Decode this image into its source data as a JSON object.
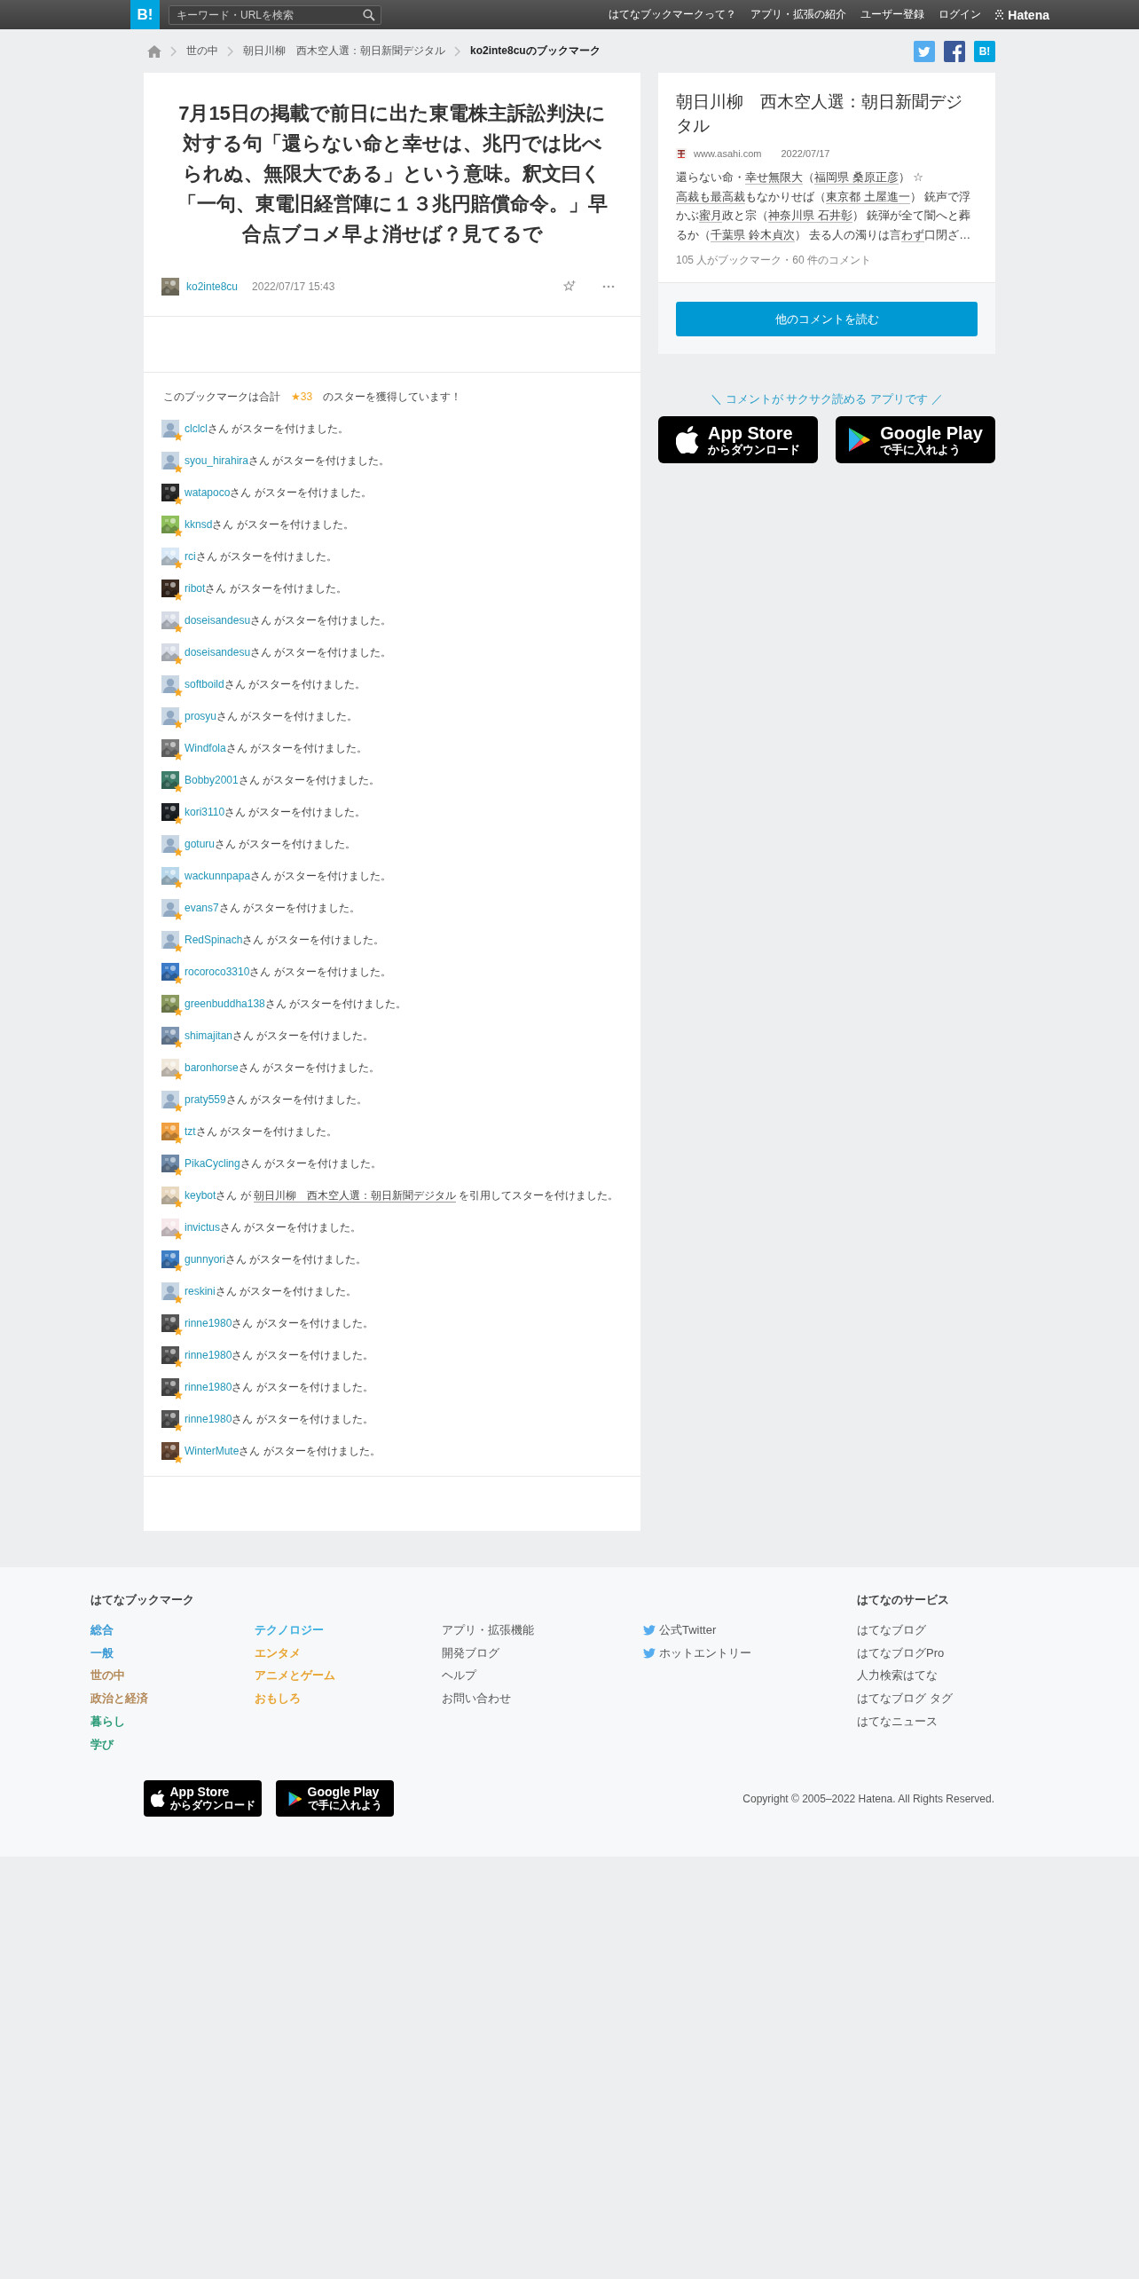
{
  "header": {
    "logo": "B!",
    "search": {
      "placeholder": "キーワード・URLを検索"
    },
    "nav": [
      "はてなブックマークって？",
      "アプリ・拡張の紹介",
      "ユーザー登録",
      "ログイン"
    ],
    "brand": "Hatena"
  },
  "breadcrumb": [
    {
      "label": "世の中",
      "current": false
    },
    {
      "label": "朝日川柳　西木空人選：朝日新聞デジタル",
      "current": false
    },
    {
      "label": "ko2inte8cuのブックマーク",
      "current": true
    }
  ],
  "share": [
    {
      "kind": "twitter"
    },
    {
      "kind": "facebook"
    },
    {
      "kind": "hatena",
      "label": "B!"
    }
  ],
  "bookmark": {
    "title": "7月15日の掲載で前日に出た東電株主訴訟判決に対する句「還らない命と幸せは、兆円では比べられぬ、無限大である」という意味。釈文曰く「一句、東電旧経営陣に１３兆円賠償命令。」早合点ブコメ早よ消せば？見てるで",
    "user": "ko2inte8cu",
    "date": "2022/07/17 15:43"
  },
  "stars": {
    "prefix": "このブックマークは合計",
    "total": "★33",
    "suffix": "のスターを獲得しています！",
    "list": [
      {
        "user": "clclcl",
        "avatar": {
          "kind": "default"
        },
        "text": "さん がスターを付けました。"
      },
      {
        "user": "syou_hirahira",
        "avatar": {
          "kind": "default"
        },
        "text": "さん がスターを付けました。"
      },
      {
        "user": "watapoco",
        "text": "さん がスターを付けました。"
      },
      {
        "user": "kknsd",
        "text": "さん がスターを付けました。"
      },
      {
        "user": "rci",
        "text": "さん がスターを付けました。"
      },
      {
        "user": "ribot",
        "text": "さん がスターを付けました。"
      },
      {
        "user": "doseisandesu",
        "text": "さん がスターを付けました。"
      },
      {
        "user": "doseisandesu",
        "text": "さん がスターを付けました。"
      },
      {
        "user": "softboild",
        "avatar": {
          "kind": "default"
        },
        "text": "さん がスターを付けました。"
      },
      {
        "user": "prosyu",
        "avatar": {
          "kind": "default"
        },
        "text": "さん がスターを付けました。"
      },
      {
        "user": "Windfola",
        "text": "さん がスターを付けました。"
      },
      {
        "user": "Bobby2001",
        "text": "さん がスターを付けました。"
      },
      {
        "user": "kori3110",
        "text": "さん がスターを付けました。"
      },
      {
        "user": "goturu",
        "avatar": {
          "kind": "default"
        },
        "text": "さん がスターを付けました。"
      },
      {
        "user": "wackunnpapa",
        "text": "さん がスターを付けました。"
      },
      {
        "user": "evans7",
        "avatar": {
          "kind": "default"
        },
        "text": "さん がスターを付けました。"
      },
      {
        "user": "RedSpinach",
        "avatar": {
          "kind": "default"
        },
        "text": "さん がスターを付けました。"
      },
      {
        "user": "rocoroco3310",
        "text": "さん がスターを付けました。"
      },
      {
        "user": "greenbuddha138",
        "text": "さん がスターを付けました。"
      },
      {
        "user": "shimajitan",
        "text": "さん がスターを付けました。"
      },
      {
        "user": "baronhorse",
        "text": "さん がスターを付けました。"
      },
      {
        "user": "praty559",
        "avatar": {
          "kind": "default"
        },
        "text": "さん がスターを付けました。"
      },
      {
        "user": "tzt",
        "text": "さん がスターを付けました。"
      },
      {
        "user": "PikaCycling",
        "text": "さん がスターを付けました。"
      },
      {
        "user": "keybot",
        "text": "さん が",
        "quote": "朝日川柳　西木空人選：朝日新聞デジタル",
        "after": "を引用してスターを付けました。"
      },
      {
        "user": "invictus",
        "text": "さん がスターを付けました。"
      },
      {
        "user": "gunnyori",
        "text": "さん がスターを付けました。"
      },
      {
        "user": "reskini",
        "avatar": {
          "kind": "default"
        },
        "text": "さん がスターを付けました。"
      },
      {
        "user": "rinne1980",
        "text": "さん がスターを付けました。"
      },
      {
        "user": "rinne1980",
        "text": "さん がスターを付けました。"
      },
      {
        "user": "rinne1980",
        "text": "さん がスターを付けました。"
      },
      {
        "user": "rinne1980",
        "text": "さん がスターを付けました。"
      },
      {
        "user": "WinterMute",
        "text": "さん がスターを付けました。"
      }
    ]
  },
  "entry": {
    "title": "朝日川柳　西木空人選：朝日新聞デジタル",
    "domain": "www.asahi.com",
    "date": "2022/07/17",
    "description": [
      {
        "text": "還らない命・",
        "keyword": false
      },
      {
        "text": "幸せ無限大",
        "keyword": true
      },
      {
        "text": "（",
        "keyword": false
      },
      {
        "text": "福岡県 桑原正彦",
        "keyword": true
      },
      {
        "text": "） ☆",
        "keyword": false
      },
      {
        "text": "高裁も最高裁",
        "keyword": true
      },
      {
        "text": "もなかりせば（",
        "keyword": false
      },
      {
        "text": "東京都 土屋進一",
        "keyword": true
      },
      {
        "text": "） 銃声で浮かぶ",
        "keyword": false
      },
      {
        "text": "蜜月",
        "keyword": true
      },
      {
        "text": "政と宗（",
        "keyword": false
      },
      {
        "text": "神奈川県 石井彰",
        "keyword": true
      },
      {
        "text": "） 銃弾が全て闇へと葬るか（",
        "keyword": false
      },
      {
        "text": "千葉県 鈴木貞次",
        "keyword": true
      },
      {
        "text": "） 去る人の濁りは言",
        "keyword": false
      },
      {
        "text": "わず",
        "keyword": true
      },
      {
        "text": "口閉ざ…",
        "keyword": false
      }
    ],
    "counts": "105 人がブックマーク・60 件のコメント",
    "button": "他のコメントを読む"
  },
  "app_promo": {
    "text": "＼ コメントが サクサク読める アプリです ／",
    "badges": [
      {
        "kind": "apple",
        "title": "App Store",
        "subtitle": "からダウンロード"
      },
      {
        "kind": "google",
        "title": "Google Play",
        "subtitle": "で手に入れよう"
      }
    ]
  },
  "footer": {
    "heading": "はてなブックマーク",
    "columns": [
      [
        {
          "label": "総合",
          "color": "#3a9bd5"
        },
        {
          "label": "一般",
          "color": "#3a9bd5"
        },
        {
          "label": "世の中",
          "color": "#b48a5a"
        },
        {
          "label": "政治と経済",
          "color": "#b48a5a"
        },
        {
          "label": "暮らし",
          "color": "#2e9c78"
        },
        {
          "label": "学び",
          "color": "#2e9c78"
        }
      ],
      [
        {
          "label": "テクノロジー",
          "color": "#3fb0df"
        },
        {
          "label": "エンタメ",
          "color": "#e8a534"
        },
        {
          "label": "アニメとゲーム",
          "color": "#e8a534"
        },
        {
          "label": "おもしろ",
          "color": "#e8a534"
        }
      ],
      [
        {
          "label": "アプリ・拡張機能"
        },
        {
          "label": "開発ブログ"
        },
        {
          "label": "ヘルプ"
        },
        {
          "label": "お問い合わせ"
        }
      ],
      [
        {
          "label": "公式Twitter",
          "kind": "twitter"
        },
        {
          "label": "ホットエントリー",
          "kind": "twitter"
        }
      ]
    ],
    "services_heading": "はてなのサービス",
    "services": [
      "はてなブログ",
      "はてなブログPro",
      "人力検索はてな",
      "はてなブログ タグ",
      "はてなニュース"
    ],
    "badges": [
      {
        "kind": "apple",
        "title": "App Store",
        "subtitle": "からダウンロード"
      },
      {
        "kind": "google",
        "title": "Google Play",
        "subtitle": "で手に入れよう"
      }
    ],
    "copyright": "Copyright © 2005–2022 Hatena. All Rights Reserved."
  }
}
